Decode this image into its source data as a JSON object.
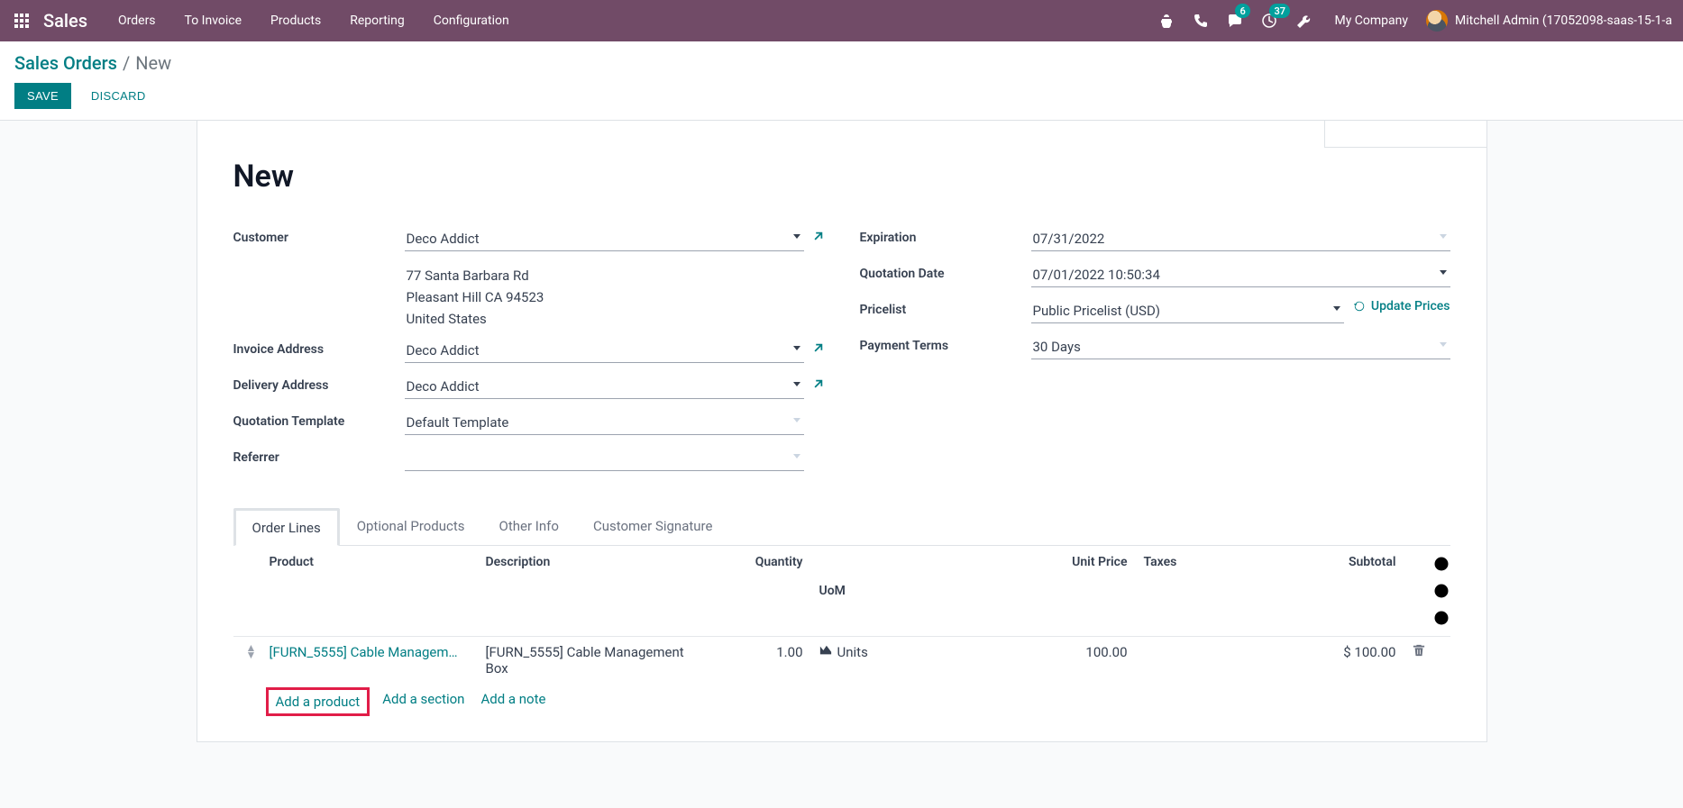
{
  "navbar": {
    "brand": "Sales",
    "menu": [
      "Orders",
      "To Invoice",
      "Products",
      "Reporting",
      "Configuration"
    ],
    "chat_badge": "6",
    "activity_badge": "37",
    "company": "My Company",
    "user": "Mitchell Admin (17052098-saas-15-1-a"
  },
  "breadcrumb": {
    "root": "Sales Orders",
    "sep": "/",
    "current": "New"
  },
  "actions": {
    "save": "SAVE",
    "discard": "DISCARD"
  },
  "form": {
    "title": "New",
    "left": {
      "customer_label": "Customer",
      "customer_value": "Deco Addict",
      "address_line1": "77 Santa Barbara Rd",
      "address_line2": "Pleasant Hill CA 94523",
      "address_line3": "United States",
      "invoice_label": "Invoice Address",
      "invoice_value": "Deco Addict",
      "delivery_label": "Delivery Address",
      "delivery_value": "Deco Addict",
      "template_label": "Quotation Template",
      "template_value": "Default Template",
      "referrer_label": "Referrer",
      "referrer_value": ""
    },
    "right": {
      "expiration_label": "Expiration",
      "expiration_value": "07/31/2022",
      "quotation_date_label": "Quotation Date",
      "quotation_date_value": "07/01/2022 10:50:34",
      "pricelist_label": "Pricelist",
      "pricelist_value": "Public Pricelist (USD)",
      "update_prices": "Update Prices",
      "payment_terms_label": "Payment Terms",
      "payment_terms_value": "30 Days"
    }
  },
  "tabs": [
    "Order Lines",
    "Optional Products",
    "Other Info",
    "Customer Signature"
  ],
  "lines": {
    "headers": {
      "product": "Product",
      "description": "Description",
      "quantity": "Quantity",
      "uom": "UoM",
      "unit_price": "Unit Price",
      "taxes": "Taxes",
      "subtotal": "Subtotal"
    },
    "rows": [
      {
        "product": "[FURN_5555] Cable Managem…",
        "description": "[FURN_5555] Cable Management Box",
        "quantity": "1.00",
        "uom": "Units",
        "unit_price": "100.00",
        "taxes": "",
        "subtotal": "$ 100.00"
      }
    ],
    "add_product": "Add a product",
    "add_section": "Add a section",
    "add_note": "Add a note"
  }
}
